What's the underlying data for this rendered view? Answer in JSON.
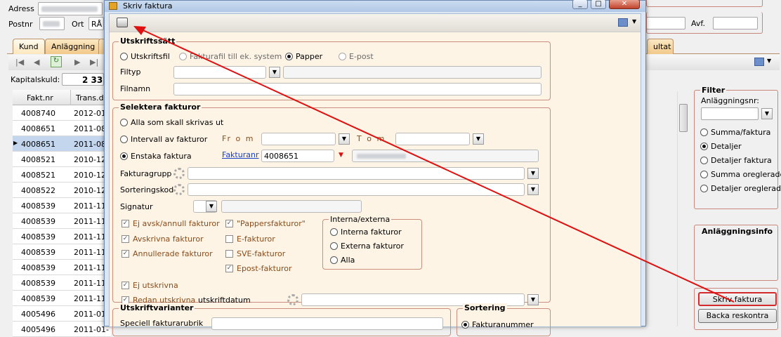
{
  "bg": {
    "adress_label": "Adress",
    "postnr_label": "Postnr",
    "ort_label": "Ort",
    "ort_value": "RÅ",
    "avf_label": "Avf.",
    "tabs": [
      "Kund",
      "Anläggning",
      "ultat"
    ],
    "kapitalskuld_label": "Kapitalskuld:",
    "kapitalskuld_value": "2 33",
    "grid_headers": [
      "Fakt.nr",
      "Trans.da"
    ],
    "rows": [
      {
        "nr": "4008740",
        "date": "2012-01-"
      },
      {
        "nr": "4008651",
        "date": "2011-08-"
      },
      {
        "nr": "4008651",
        "date": "2011-08-"
      },
      {
        "nr": "4008521",
        "date": "2010-12-"
      },
      {
        "nr": "4008521",
        "date": "2010-12-"
      },
      {
        "nr": "4008522",
        "date": "2010-12-"
      },
      {
        "nr": "4008539",
        "date": "2011-11-"
      },
      {
        "nr": "4008539",
        "date": "2011-11-"
      },
      {
        "nr": "4008539",
        "date": "2011-11-"
      },
      {
        "nr": "4008539",
        "date": "2011-11-"
      },
      {
        "nr": "4008539",
        "date": "2011-11-"
      },
      {
        "nr": "4008539",
        "date": "2011-11-"
      },
      {
        "nr": "4008539",
        "date": "2011-11-"
      },
      {
        "nr": "4005496",
        "date": "2011-01-"
      },
      {
        "nr": "4005496",
        "date": "2011-01-"
      }
    ],
    "filter": {
      "title": "Filter",
      "anl_label": "Anläggningsnr:",
      "options": [
        "Summa/faktura",
        "Detaljer",
        "Detaljer faktura",
        "Summa oreglerade",
        "Detaljer oreglerade"
      ]
    },
    "info_title": "Anläggningsinfo",
    "skriv_button": "Skriv faktura",
    "backa_button": "Backa reskontra"
  },
  "dialog": {
    "title": "Skriv faktura",
    "utskriftssatt": {
      "title": "Utskriftssätt",
      "options": [
        "Utskriftsfil",
        "Fakturafil till ek. system",
        "Papper",
        "E-post"
      ],
      "filtyp_label": "Filtyp",
      "filnamn_label": "Filnamn"
    },
    "selektera": {
      "title": "Selektera fakturor",
      "alla": "Alla som skall skrivas ut",
      "intervall": "Intervall av fakturor",
      "from": "Fr o m",
      "tom": "T o m",
      "enstaka": "Enstaka faktura",
      "fakturanr_link": "Fakturanr",
      "fakturanr_value": "4008651",
      "fakturagrupp": "Fakturagrupp",
      "sorteringskod": "Sorteringskod",
      "signatur": "Signatur",
      "checks_col1": [
        "Ej avsk/annull fakturor",
        "Avskrivna fakturor",
        "Annullerade fakturor"
      ],
      "checks_col2": [
        "\"Pappersfakturor\"",
        "E-fakturor",
        "SVE-fakturor",
        "Epost-fakturor"
      ],
      "interna_title": "Interna/externa",
      "interna_options": [
        "Interna fakturor",
        "Externa fakturor",
        "Alla"
      ],
      "ej_utskrivna": "Ej utskrivna",
      "redan_utskrivna": "Redan utskrivna",
      "utskriftdatum": "utskriftdatum"
    },
    "varianter": {
      "title": "Utskriftvarianter",
      "speciell": "Speciell fakturarubrik"
    },
    "sortering": {
      "title": "Sortering",
      "option": "Fakturanummer"
    }
  },
  "colors": {
    "arrow": "#e01010",
    "accent_border": "#c98e7e",
    "dialog_bg": "#fdf4e6"
  }
}
